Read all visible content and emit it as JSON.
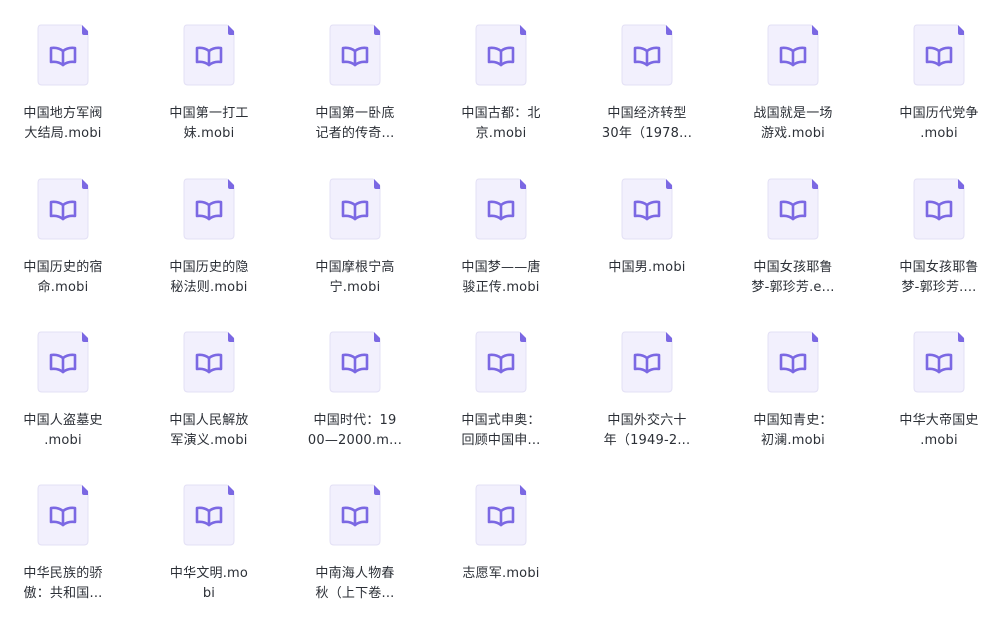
{
  "files": [
    {
      "line1": "中国地方军阀",
      "line2": "大结局.mobi",
      "icon": "ebook-file-icon"
    },
    {
      "line1": "中国第一打工",
      "line2": "妹.mobi",
      "icon": "ebook-file-icon"
    },
    {
      "line1": "中国第一卧底",
      "line2": "记者的传奇...",
      "icon": "ebook-file-icon"
    },
    {
      "line1": "中国古都：北",
      "line2": "京.mobi",
      "icon": "ebook-file-icon"
    },
    {
      "line1": "中国经济转型",
      "line2": "30年（1978...",
      "icon": "ebook-file-icon"
    },
    {
      "line1": "战国就是一场",
      "line2": "游戏.mobi",
      "icon": "ebook-file-icon"
    },
    {
      "line1": "中国历代党争",
      "line2": ".mobi",
      "icon": "ebook-file-icon"
    },
    {
      "line1": "中国历史的宿",
      "line2": "命.mobi",
      "icon": "ebook-file-icon"
    },
    {
      "line1": "中国历史的隐",
      "line2": "秘法则.mobi",
      "icon": "ebook-file-icon"
    },
    {
      "line1": "中国摩根宁高",
      "line2": "宁.mobi",
      "icon": "ebook-file-icon"
    },
    {
      "line1": "中国梦——唐",
      "line2": "骏正传.mobi",
      "icon": "ebook-file-icon"
    },
    {
      "line1": "中国男.mobi",
      "line2": "",
      "icon": "ebook-file-icon"
    },
    {
      "line1": "中国女孩耶鲁",
      "line2": "梦-郭珍芳.e...",
      "icon": "ebook-file-icon"
    },
    {
      "line1": "中国女孩耶鲁",
      "line2": "梦-郭珍芳....",
      "icon": "ebook-file-icon"
    },
    {
      "line1": "中国人盗墓史",
      "line2": ".mobi",
      "icon": "ebook-file-icon"
    },
    {
      "line1": "中国人民解放",
      "line2": "军演义.mobi",
      "icon": "ebook-file-icon"
    },
    {
      "line1": "中国时代：19",
      "line2": "00—2000.m...",
      "icon": "ebook-file-icon"
    },
    {
      "line1": "中国式申奥：",
      "line2": "回顾中国申...",
      "icon": "ebook-file-icon"
    },
    {
      "line1": "中国外交六十",
      "line2": "年（1949-2...",
      "icon": "ebook-file-icon"
    },
    {
      "line1": "中国知青史：",
      "line2": "初澜.mobi",
      "icon": "ebook-file-icon"
    },
    {
      "line1": "中华大帝国史",
      "line2": ".mobi",
      "icon": "ebook-file-icon"
    },
    {
      "line1": "中华民族的骄",
      "line2": "傲：共和国...",
      "icon": "ebook-file-icon"
    },
    {
      "line1": "中华文明.mo",
      "line2": "bi",
      "icon": "ebook-file-icon"
    },
    {
      "line1": "中南海人物春",
      "line2": "秋（上下卷...",
      "icon": "ebook-file-icon"
    },
    {
      "line1": "志愿军.mobi",
      "line2": "",
      "icon": "ebook-file-icon"
    }
  ],
  "colors": {
    "doc_bg": "#f2f0fd",
    "doc_border": "#e3e0f5",
    "doc_corner": "#7b68e3",
    "book": "#7b68e3",
    "text": "#2b2f36"
  }
}
